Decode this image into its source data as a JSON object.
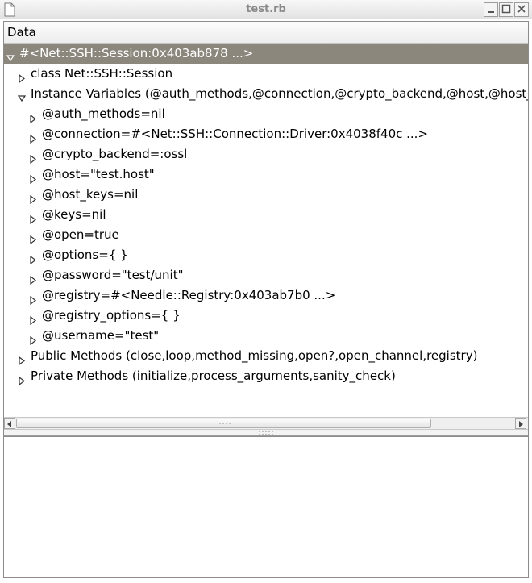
{
  "window": {
    "title": "test.rb",
    "icons": {
      "app": "document-icon",
      "minimize": "minimize-icon",
      "maximize": "maximize-icon",
      "close": "close-icon"
    }
  },
  "tree": {
    "column_header": "Data",
    "rows": [
      {
        "label": "#<Net::SSH::Session:0x403ab878 ...>",
        "expanded": true
      },
      {
        "label": "class Net::SSH::Session",
        "expanded": false
      },
      {
        "label": "Instance Variables (@auth_methods,@connection,@crypto_backend,@host,@host_keys,@keys,@open,@options,@password,@registry,@registry_options,@username)",
        "expanded": true
      },
      {
        "label": "@auth_methods=nil",
        "expanded": false
      },
      {
        "label": "@connection=#<Net::SSH::Connection::Driver:0x4038f40c ...>",
        "expanded": false
      },
      {
        "label": "@crypto_backend=:ossl",
        "expanded": false
      },
      {
        "label": "@host=\"test.host\"",
        "expanded": false
      },
      {
        "label": "@host_keys=nil",
        "expanded": false
      },
      {
        "label": "@keys=nil",
        "expanded": false
      },
      {
        "label": "@open=true",
        "expanded": false
      },
      {
        "label": "@options={ }",
        "expanded": false
      },
      {
        "label": "@password=\"test/unit\"",
        "expanded": false
      },
      {
        "label": "@registry=#<Needle::Registry:0x403ab7b0 ...>",
        "expanded": false
      },
      {
        "label": "@registry_options={ }",
        "expanded": false
      },
      {
        "label": "@username=\"test\"",
        "expanded": false
      },
      {
        "label": "Public Methods (close,loop,method_missing,open?,open_channel,registry)",
        "expanded": false
      },
      {
        "label": "Private Methods (initialize,process_arguments,sanity_check)",
        "expanded": false
      }
    ]
  },
  "scrollbar": {
    "left_icon": "scroll-left-arrow-icon",
    "right_icon": "scroll-right-arrow-icon"
  },
  "colors": {
    "selection": "#8b877d",
    "border": "#8c8c8c"
  }
}
